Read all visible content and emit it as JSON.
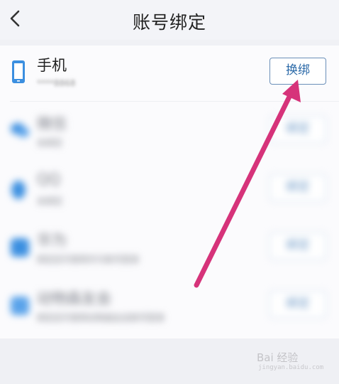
{
  "header": {
    "back_icon": "chevron-left-icon",
    "title": "账号绑定"
  },
  "accounts": [
    {
      "name": "手机",
      "detail": "****8868",
      "action": "换绑",
      "icon": "phone-icon",
      "icon_color": "#3b8fe0"
    },
    {
      "name": "微信",
      "detail": "未绑定",
      "action": "绑定",
      "icon": "wechat-icon",
      "icon_color": "#3b8fe0"
    },
    {
      "name": "QQ",
      "detail": "未绑定",
      "action": "绑定",
      "icon": "qq-icon",
      "icon_color": "#3b8fe0"
    },
    {
      "name": "华为",
      "detail": "绑定后可使用华为账号登录",
      "action": "绑定",
      "icon": "huawei-icon",
      "icon_color": "#3b8fe0"
    },
    {
      "name": "动物森友会",
      "detail": "绑定后可使用动物森友会账号登录",
      "action": "绑定",
      "icon": "game-icon",
      "icon_color": "#3b8fe0"
    }
  ],
  "annotation": {
    "color": "#d6337a",
    "target": "换绑"
  },
  "watermark": {
    "text": "Bai 经验",
    "sub": "jingyan.baidu.com"
  }
}
